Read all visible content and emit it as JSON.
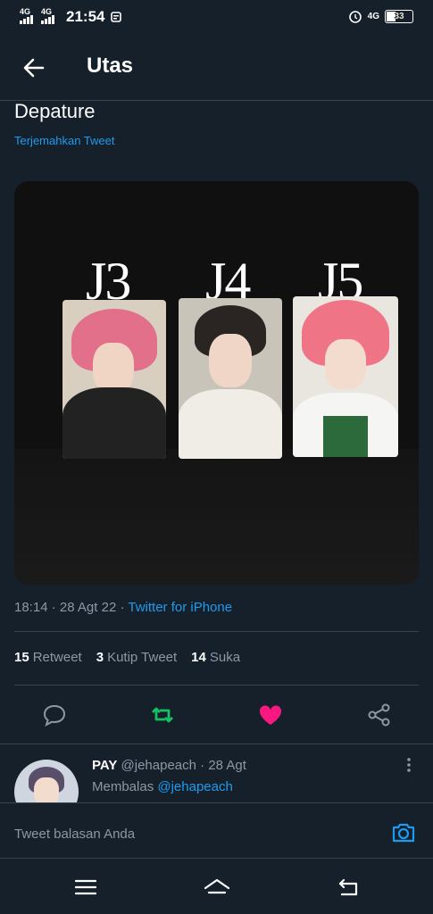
{
  "status_bar": {
    "net1": "4G",
    "net2": "4G",
    "time": "21:54",
    "net3": "4G",
    "battery": "33"
  },
  "header": {
    "title": "Utas"
  },
  "tweet": {
    "text": "Depature",
    "translate_link": "Terjemahkan Tweet",
    "photo_labels": [
      "J3",
      "J4",
      "J5"
    ],
    "time": "18:14",
    "date": "28 Agt 22",
    "source": "Twitter for iPhone"
  },
  "stats": [
    {
      "count": "15",
      "label": "Retweet"
    },
    {
      "count": "3",
      "label": "Kutip Tweet"
    },
    {
      "count": "14",
      "label": "Suka"
    }
  ],
  "actions": [
    "reply-icon",
    "retweet-icon",
    "like-icon",
    "share-icon"
  ],
  "reply": {
    "name": "PAY",
    "handle": "@jehapeach",
    "date": "28 Agt",
    "replying_prefix": "Membalas",
    "replying_to": "@jehapeach"
  },
  "composer": {
    "placeholder": "Tweet balasan Anda"
  },
  "colors": {
    "accent": "#1d9bf0",
    "retweet": "#17bf63",
    "like": "#f91880",
    "background": "#15202b"
  }
}
